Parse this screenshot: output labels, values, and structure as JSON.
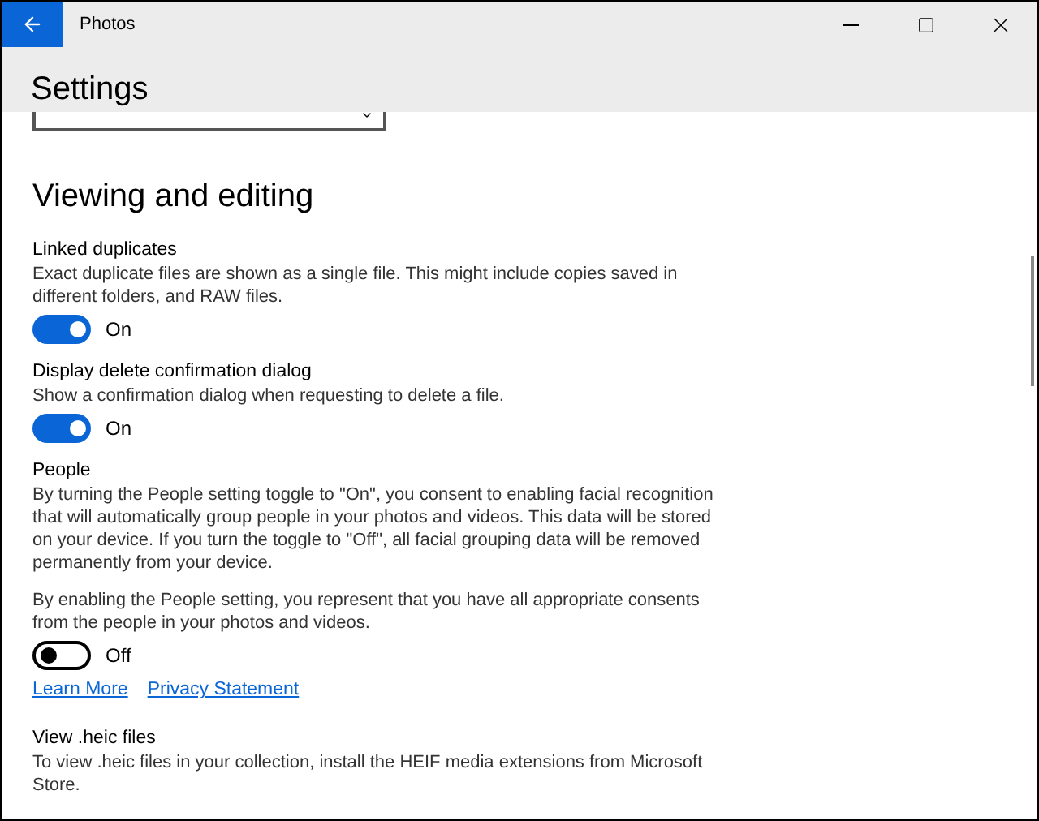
{
  "window": {
    "title": "Photos"
  },
  "page_title": "Settings",
  "section": {
    "heading": "Viewing and editing",
    "settings": [
      {
        "kind": "toggle",
        "label": "Linked duplicates",
        "paragraphs": [
          "Exact duplicate files are shown as a single file. This might include copies saved in different folders, and RAW files."
        ],
        "toggle": {
          "on": true,
          "label": "On"
        }
      },
      {
        "kind": "toggle",
        "label": "Display delete confirmation dialog",
        "paragraphs": [
          "Show a confirmation dialog when requesting to delete a file."
        ],
        "toggle": {
          "on": true,
          "label": "On"
        }
      },
      {
        "kind": "toggle",
        "label": "People",
        "paragraphs": [
          "By turning the People setting toggle to \"On\", you consent to enabling facial recognition that will automatically group people in your photos and videos. This data will be stored on your device. If you turn the toggle to \"Off\", all facial grouping data will be removed permanently from your device.",
          "By enabling the People setting, you represent that you have all appropriate consents from the people in your photos and videos."
        ],
        "toggle": {
          "on": false,
          "label": "Off"
        },
        "links": [
          "Learn More",
          "Privacy Statement"
        ]
      },
      {
        "kind": "info",
        "label": "View .heic files",
        "paragraphs": [
          "To view .heic files in your collection, install the HEIF media extensions from Microsoft Store."
        ]
      }
    ]
  }
}
